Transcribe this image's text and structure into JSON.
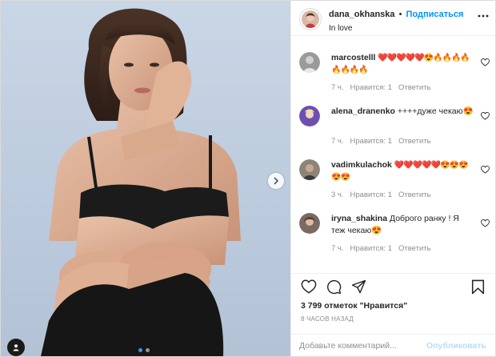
{
  "post": {
    "author": "dana_okhanska",
    "separator": "•",
    "follow_label": "Подписаться",
    "location": "In love",
    "photo_dots": [
      "dot-1",
      "dot-2"
    ],
    "active_dot_index": 0
  },
  "comments": [
    {
      "user": "marcostelll",
      "text": "❤️❤️❤️❤️❤️😍🔥🔥🔥🔥🔥🔥🔥🔥",
      "time": "7 ч.",
      "likes": "Нравится: 1",
      "reply": "Ответить"
    },
    {
      "user": "alena_dranenko",
      "text": "++++дуже чекаю😍",
      "time": "7 ч.",
      "likes": "Нравится: 1",
      "reply": "Ответить"
    },
    {
      "user": "vadimkulachok",
      "text": "❤️❤️❤️❤️❤️😍😍😍😍😍",
      "time": "3 ч.",
      "likes": "Нравится: 1",
      "reply": "Ответить"
    },
    {
      "user": "iryna_shakina",
      "text": "Доброго ранку ! Я теж чекаю😍",
      "time": "7 ч.",
      "likes": "Нравится: 1",
      "reply": "Ответить"
    }
  ],
  "actions": {
    "likes_text": "3 799 отметок \"Нравится\"",
    "time_ago": "8 ЧАСОВ НАЗАД",
    "comment_placeholder": "Добавьте комментарий...",
    "publish_label": "Опубликовать"
  },
  "colors": {
    "accent": "#0095f6",
    "muted": "#8e8e8e",
    "border": "#dbdbdb",
    "publish_disabled": "#b2dffc"
  },
  "icons": [
    "heart-icon",
    "comment-icon",
    "share-icon",
    "bookmark-icon",
    "more-icon",
    "chevron-right-icon"
  ]
}
